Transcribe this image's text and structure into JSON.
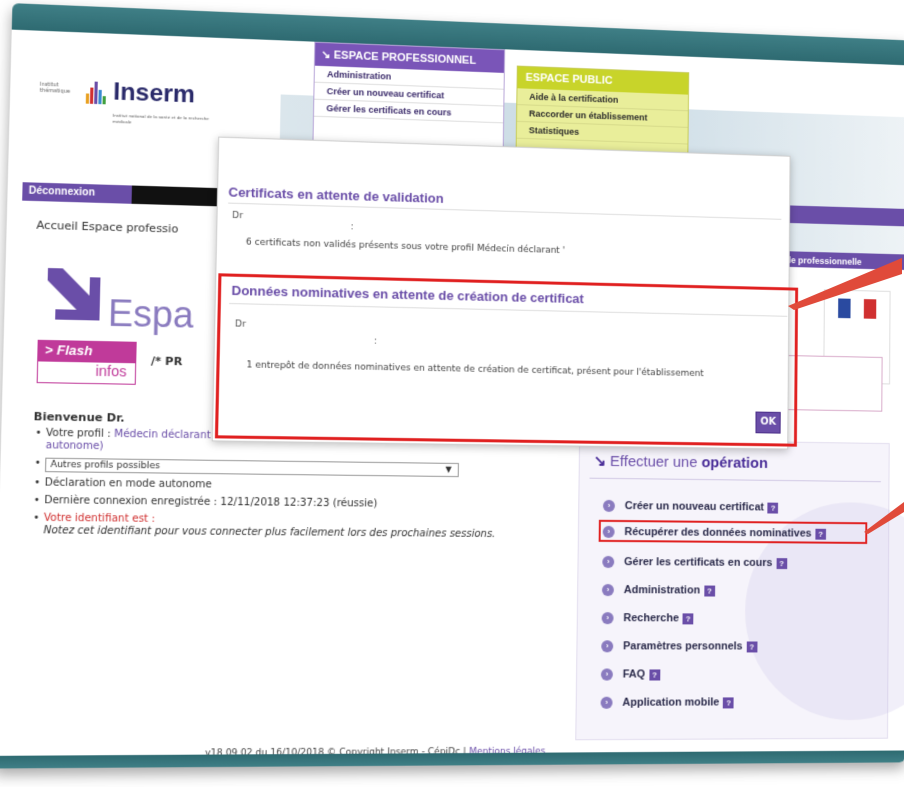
{
  "header": {
    "logo_small": "Institut thématique",
    "logo_name": "Inserm",
    "logo_sub": "Institut national de la santé et de la recherche médicale"
  },
  "menu_pro": {
    "title": "ESPACE PROFESSIONNEL",
    "items": [
      "Administration",
      "Créer un nouveau certificat",
      "Gérer les certificats en cours"
    ]
  },
  "menu_pub": {
    "title": "ESPACE PUBLIC",
    "items": [
      "Aide à la certification",
      "Raccorder un établissement",
      "Statistiques"
    ]
  },
  "nav": {
    "deconnexion": "Déconnexion",
    "breadcrumb": "Accueil Espace professio",
    "right_links": "s  ⓘ Aide professionnelle"
  },
  "page": {
    "title": "Espa",
    "flash_top": "> Flash",
    "flash_bottom": "infos",
    "flash_text": "/* PR"
  },
  "welcome": {
    "bienvenue": "Bienvenue Dr.",
    "profil_label": "Votre profil : ",
    "profil_value": "Médecin déclarant (",
    "profil_value2": "autonome)",
    "declaration_link": "'Déclaration en mode",
    "select_value": "Autres profils possibles",
    "mode": "Déclaration en mode autonome",
    "last_connection": "Dernière connexion enregistrée : 12/11/2018 12:37:23 (réussie)",
    "identifiant": "Votre identifiant est :",
    "note": "Notez cet identifiant pour vous connecter plus facilement lors des prochaines sessions."
  },
  "operations": {
    "title_prefix": "Effectuer une ",
    "title_bold": "opération",
    "items": [
      "Créer un nouveau certificat",
      "Récupérer des données nominatives",
      "Gérer les certificats en cours",
      "Administration",
      "Recherche",
      "Paramètres personnels",
      "FAQ",
      "Application mobile"
    ]
  },
  "footer": {
    "text": "v18.09.02 du 16/10/2018 © Copyright Inserm - CépiDc | ",
    "link": "Mentions légales"
  },
  "modal": {
    "title1": "Certificats en attente de validation",
    "dr1": "Dr",
    "colon1": ":",
    "text1": "6 certificats non validés présents sous votre profil Médecin déclarant '",
    "title2": "Données nominatives en attente de création de certificat",
    "dr2": "Dr",
    "colon2": ":",
    "text2": "1 entrepôt de données nominatives en attente de création de certificat, présent pour l'établissement",
    "ok": "OK"
  },
  "colors": {
    "brand_purple": "#6a4ea8",
    "brand_yellow": "#c8d42a",
    "highlight_red": "#e02020",
    "flash_magenta": "#c03a9a"
  }
}
